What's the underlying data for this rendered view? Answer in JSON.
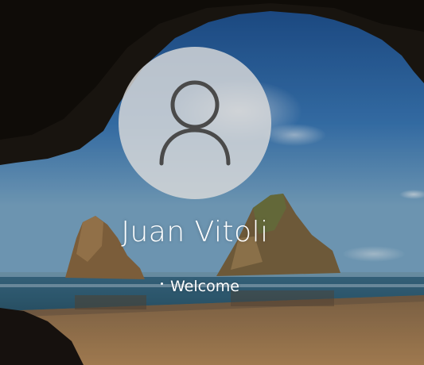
{
  "login": {
    "username": "Juan Vitoli",
    "status": "Welcome"
  },
  "icons": {
    "avatar": "user-silhouette-icon",
    "spinner": "loading-dot-icon"
  },
  "colors": {
    "avatar_circle": "#dadada",
    "avatar_figure": "#4a4a4a",
    "text": "#ffffff"
  }
}
